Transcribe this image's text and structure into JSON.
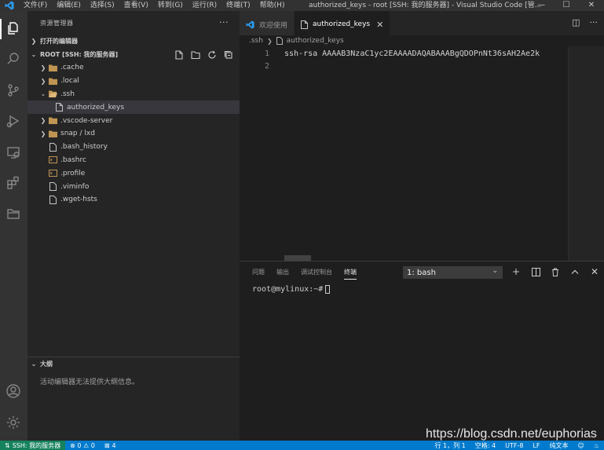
{
  "titlebar": {
    "menu": [
      "文件(F)",
      "编辑(E)",
      "选择(S)",
      "查看(V)",
      "转到(G)",
      "运行(R)",
      "终端(T)",
      "帮助(H)"
    ],
    "title": "authorized_keys - root [SSH: 我的服务器] - Visual Studio Code [管...",
    "controls": [
      "—",
      "☐",
      "✕"
    ]
  },
  "sidebar": {
    "title": "资源管理器",
    "more": "···",
    "open_editors": "打开的编辑器",
    "root": "ROOT [SSH: 我的服务器]",
    "tree": [
      {
        "label": ".cache",
        "type": "folder",
        "expanded": false
      },
      {
        "label": ".local",
        "type": "folder",
        "expanded": false
      },
      {
        "label": ".ssh",
        "type": "folder",
        "expanded": true
      },
      {
        "label": "authorized_keys",
        "type": "file",
        "selected": true
      },
      {
        "label": ".vscode-server",
        "type": "folder",
        "expanded": false
      },
      {
        "label": "snap / lxd",
        "type": "folder",
        "expanded": false
      },
      {
        "label": ".bash_history",
        "type": "file"
      },
      {
        "label": ".bashrc",
        "type": "file"
      },
      {
        "label": ".profile",
        "type": "file"
      },
      {
        "label": ".viminfo",
        "type": "file"
      },
      {
        "label": ".wget-hsts",
        "type": "file"
      }
    ],
    "outline_title": "大纲",
    "outline_message": "活动编辑器无法提供大纲信息。"
  },
  "tabs": [
    {
      "label": "欢迎使用",
      "active": false
    },
    {
      "label": "authorized_keys",
      "active": true,
      "close": "✕"
    }
  ],
  "breadcrumb": [
    ".ssh",
    "authorized_keys"
  ],
  "editor": {
    "lines": [
      {
        "num": "1",
        "text": "ssh-rsa AAAAB3NzaC1yc2EAAAADAQABAAABgQDOPnNt36sAH2Ae2k"
      },
      {
        "num": "2",
        "text": ""
      }
    ]
  },
  "panel": {
    "tabs": [
      "问题",
      "输出",
      "调试控制台",
      "终端"
    ],
    "active_tab": "终端",
    "terminal_select": "1: bash",
    "prompt": "root@mylinux:~# "
  },
  "watermark": "https://blog.csdn.net/euphorias",
  "statusbar": {
    "remote": "SSH: 我的服务器",
    "problems": "⊗ 0 ⚠ 0",
    "ports": "4",
    "position": "行 1，列 1",
    "spaces": "空格: 4",
    "encoding": "UTF-8",
    "eol": "LF",
    "language": "纯文本"
  },
  "colors": {
    "accent": "#007acc",
    "remote": "#16825d",
    "folder": "#c09553"
  }
}
